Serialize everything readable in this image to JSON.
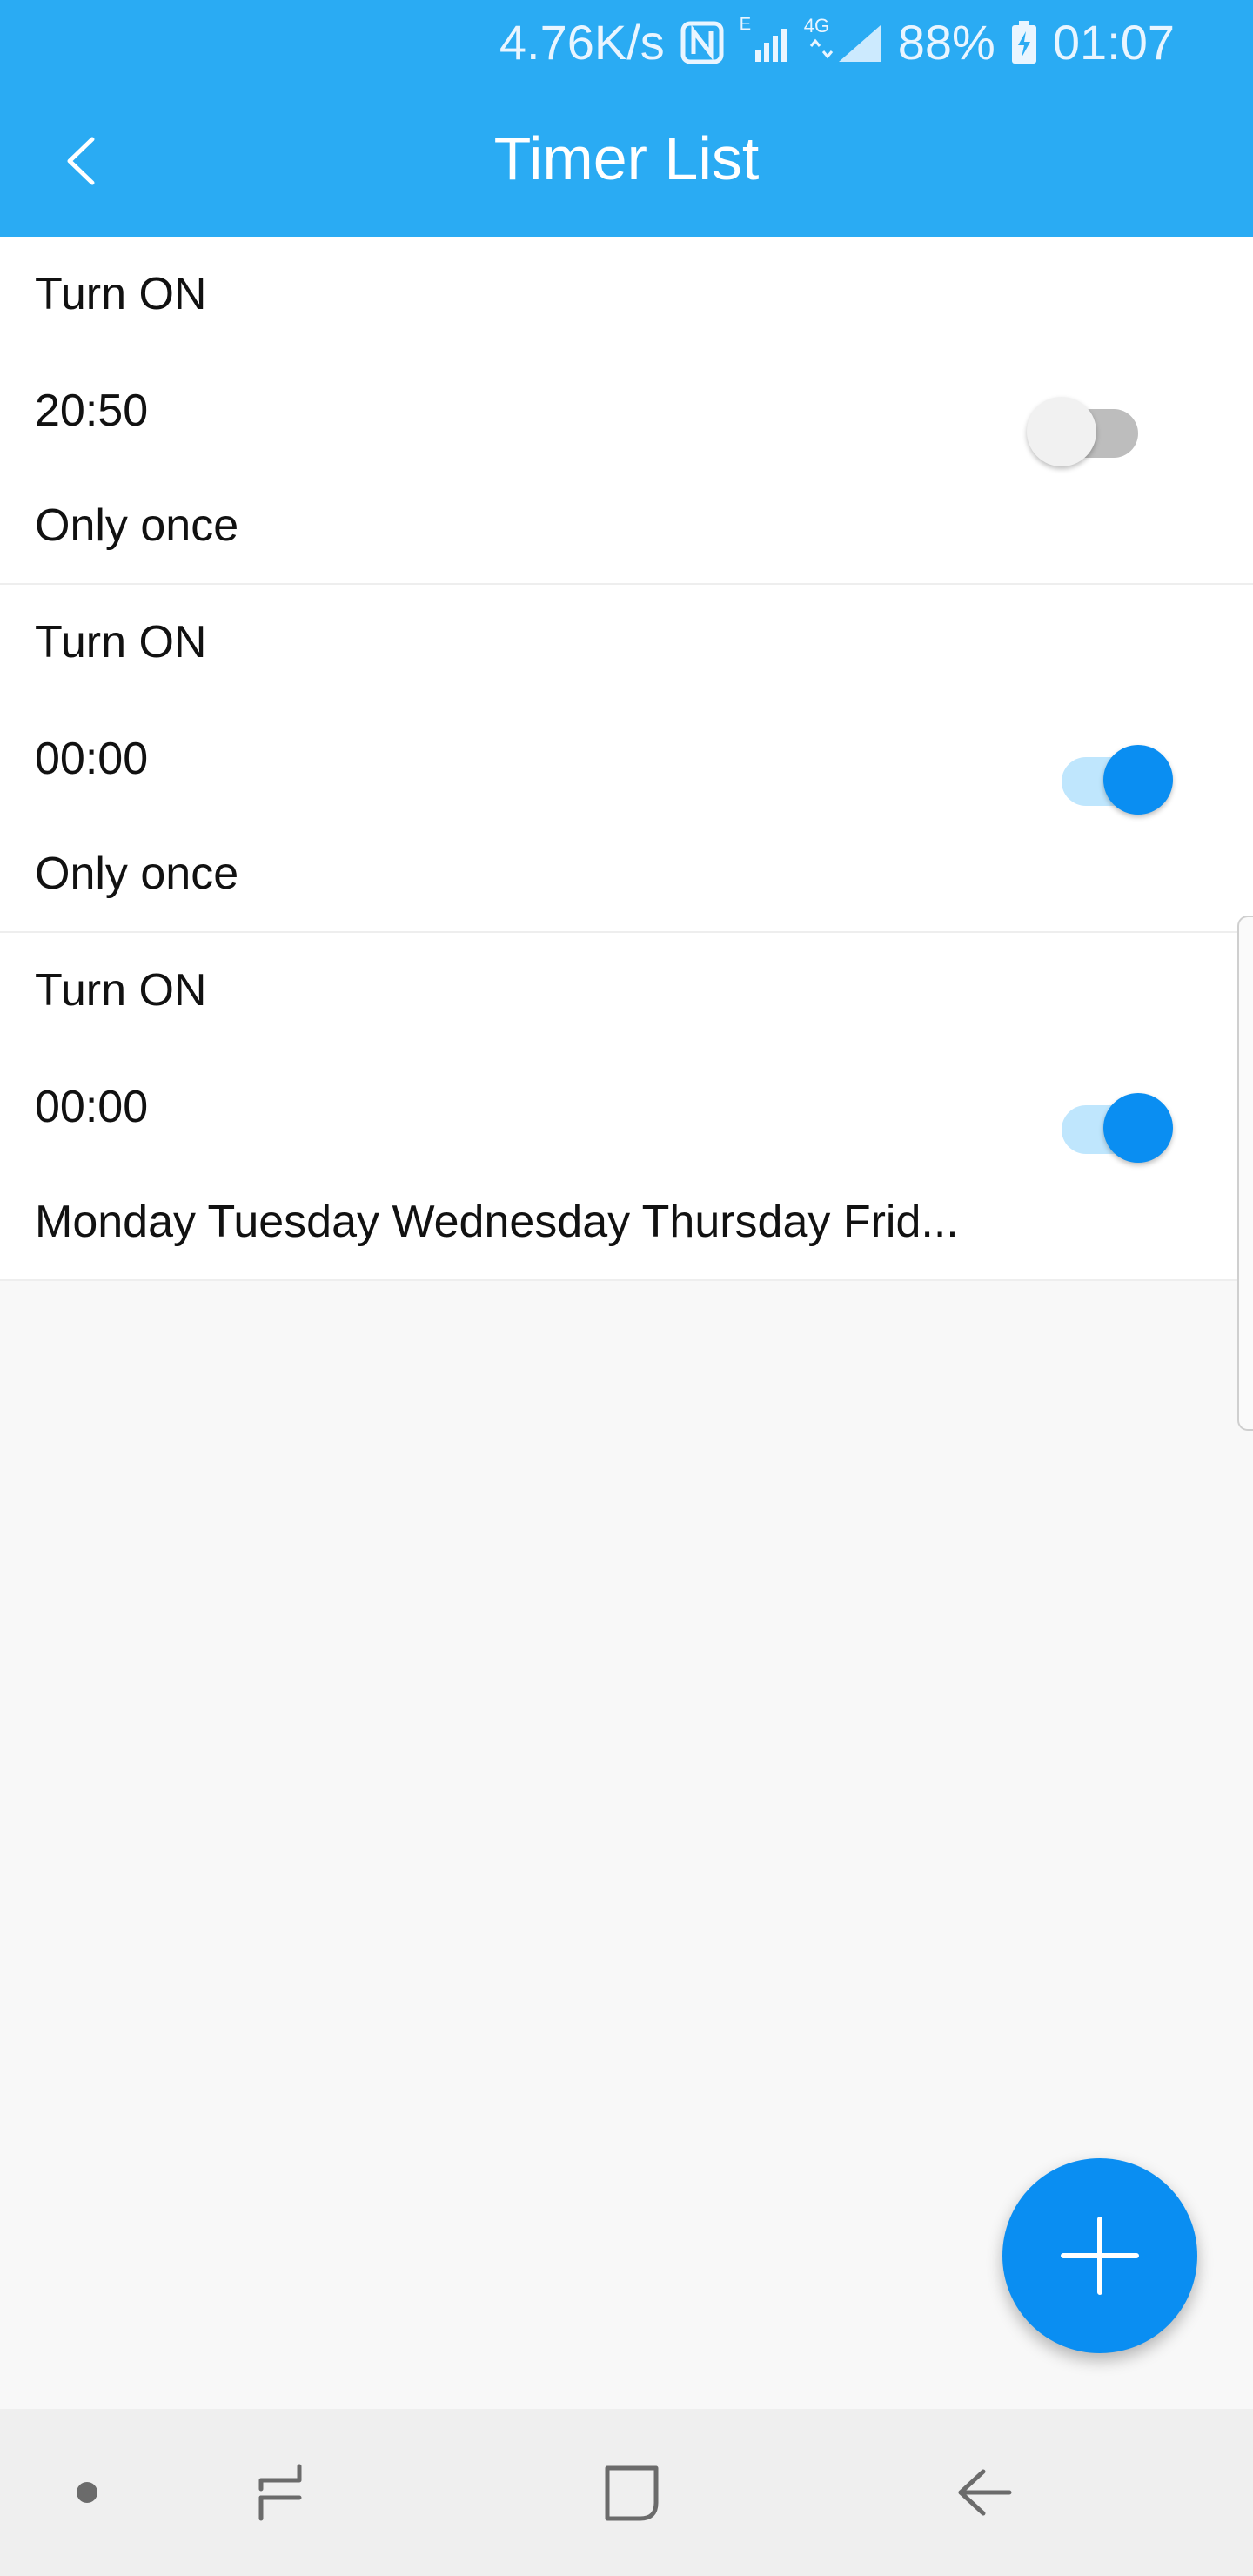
{
  "status_bar": {
    "network_speed": "4.76K/s",
    "nfc_icon": "nfc-icon",
    "signal_label_e": "E",
    "signal_label_4g": "4G",
    "battery_percent": "88%",
    "battery_icon": "battery-charging-icon",
    "time": "01:07"
  },
  "app_bar": {
    "title": "Timer List",
    "back_icon": "chevron-left-icon",
    "color": "#2aabf3"
  },
  "timers": [
    {
      "action": "Turn ON",
      "time": "20:50",
      "repeat": "Only once",
      "enabled": false
    },
    {
      "action": "Turn ON",
      "time": "00:00",
      "repeat": "Only once",
      "enabled": true
    },
    {
      "action": "Turn ON",
      "time": "00:00",
      "repeat": "Monday Tuesday Wednesday Thursday Frid...",
      "enabled": true
    }
  ],
  "fab": {
    "icon": "plus-icon",
    "color": "#0a8ef2"
  },
  "nav_bar": {
    "items": [
      "dot-icon",
      "recent-apps-icon",
      "home-icon",
      "back-arrow-icon"
    ]
  }
}
